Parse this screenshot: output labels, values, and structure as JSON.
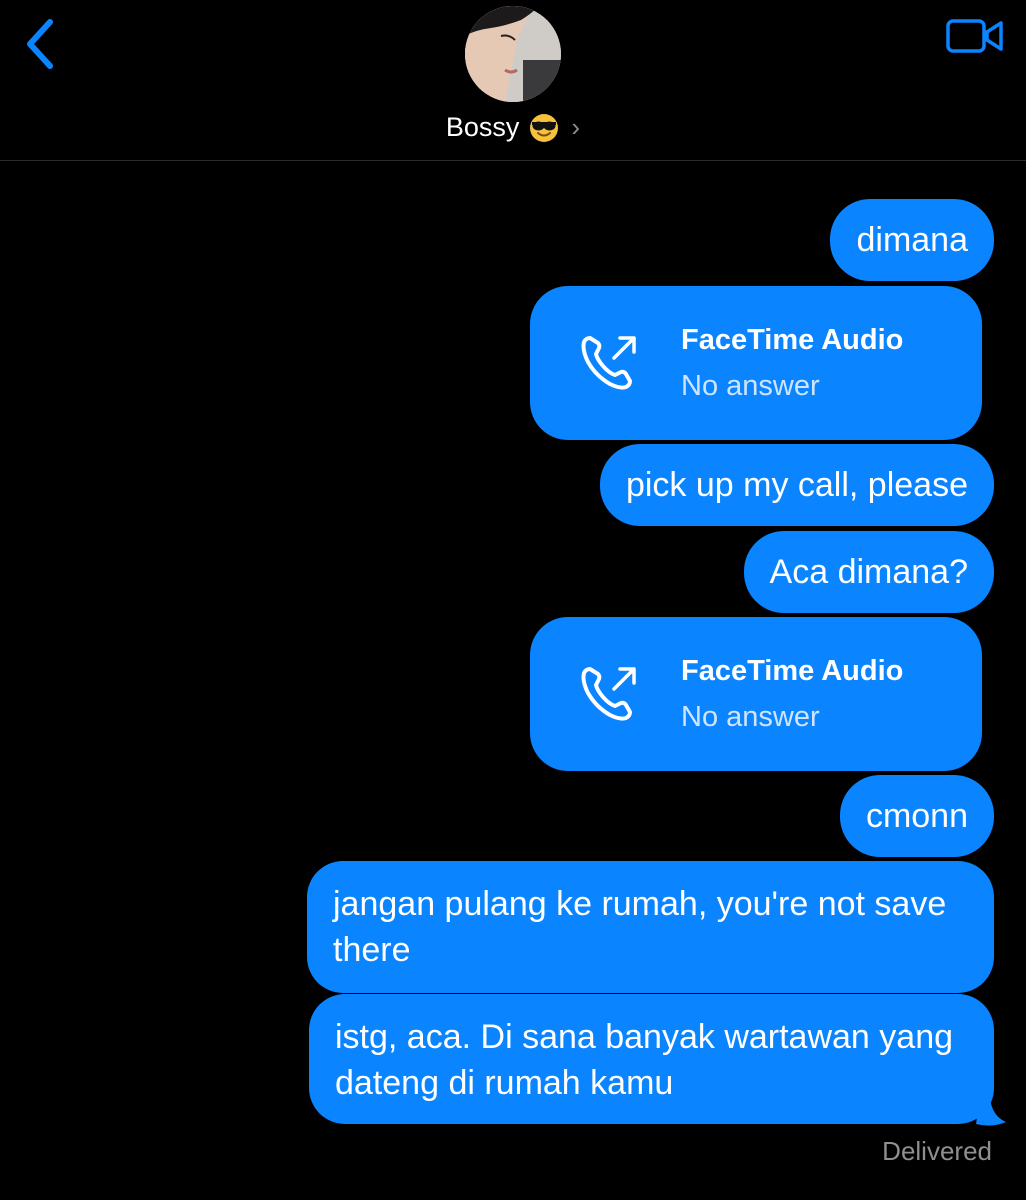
{
  "header": {
    "contact_name": "Bossy",
    "back_icon": "chevron-left-icon",
    "video_icon": "video-camera-icon",
    "accent": "#0a84ff"
  },
  "messages": [
    {
      "type": "text",
      "text": "dimana"
    },
    {
      "type": "call",
      "title": "FaceTime Audio",
      "status": "No answer"
    },
    {
      "type": "text",
      "text": "pick up my call, please"
    },
    {
      "type": "text",
      "text": "Aca dimana?"
    },
    {
      "type": "call",
      "title": "FaceTime Audio",
      "status": "No answer"
    },
    {
      "type": "text",
      "text": "cmonn"
    },
    {
      "type": "text",
      "text": "jangan pulang ke rumah, you're not save there"
    },
    {
      "type": "text",
      "text": "istg, aca. Di sana banyak wartawan yang dateng di rumah kamu"
    }
  ],
  "status": {
    "delivered_label": "Delivered"
  },
  "colors": {
    "bubble": "#0a84ff",
    "background": "#000000",
    "secondary_text": "#8e8e93"
  }
}
